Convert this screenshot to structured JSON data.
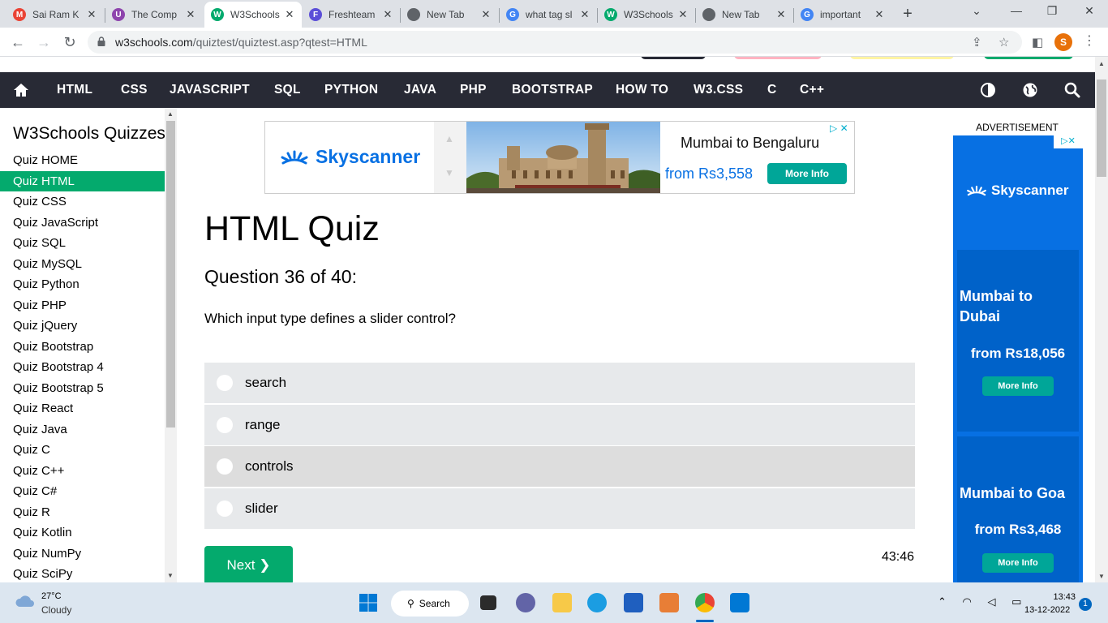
{
  "browser": {
    "tabs": [
      {
        "title": "Sai Ram K",
        "icon": "gmail-icon",
        "color": "#ea4335",
        "glyph": "M"
      },
      {
        "title": "The Comp",
        "icon": "app-icon",
        "color": "#8e44ad",
        "glyph": "U"
      },
      {
        "title": "W3Schools",
        "icon": "w3schools-icon",
        "color": "#04aa6d",
        "glyph": "W"
      },
      {
        "title": "Freshteam",
        "icon": "freshteam-icon",
        "color": "#5b4ed8",
        "glyph": "F"
      },
      {
        "title": "New Tab",
        "icon": "chrome-icon",
        "color": "#5f6368",
        "glyph": ""
      },
      {
        "title": "what tag sl",
        "icon": "google-icon",
        "color": "#4285f4",
        "glyph": "G"
      },
      {
        "title": "W3Schools",
        "icon": "w3schools-icon",
        "color": "#04aa6d",
        "glyph": "W"
      },
      {
        "title": "New Tab",
        "icon": "chrome-icon",
        "color": "#5f6368",
        "glyph": ""
      },
      {
        "title": "important",
        "icon": "google-icon",
        "color": "#4285f4",
        "glyph": "G"
      }
    ],
    "active_tab": 2,
    "url_host": "w3schools.com",
    "url_path": "/quiztest/quiztest.asp?qtest=HTML",
    "profile_initial": "S"
  },
  "topnav": {
    "items": [
      "HTML",
      "CSS",
      "JAVASCRIPT",
      "SQL",
      "PYTHON",
      "JAVA",
      "PHP",
      "BOOTSTRAP",
      "HOW TO",
      "W3.CSS",
      "C",
      "C++"
    ],
    "bg_color": "#282a35"
  },
  "sidebar": {
    "title": "W3Schools Quizzes",
    "items": [
      "Quiz HOME",
      "Quiz HTML",
      "Quiz CSS",
      "Quiz JavaScript",
      "Quiz SQL",
      "Quiz MySQL",
      "Quiz Python",
      "Quiz PHP",
      "Quiz jQuery",
      "Quiz Bootstrap",
      "Quiz Bootstrap 4",
      "Quiz Bootstrap 5",
      "Quiz React",
      "Quiz Java",
      "Quiz C",
      "Quiz C++",
      "Quiz C#",
      "Quiz R",
      "Quiz Kotlin",
      "Quiz NumPy",
      "Quiz SciPy"
    ],
    "active_index": 1,
    "accent_color": "#04aa6d"
  },
  "ad_top": {
    "brand": "Skyscanner",
    "route": "Mumbai to Bengaluru",
    "price": "from Rs3,558",
    "button": "More Info"
  },
  "quiz": {
    "title": "HTML Quiz",
    "question_count": "Question 36 of 40:",
    "question": "Which input type defines a slider control?",
    "answers": [
      "search",
      "range",
      "controls",
      "slider"
    ],
    "hover_index": 2,
    "next_label": "Next ❯",
    "timer": "43:46"
  },
  "ad_right": {
    "label": "ADVERTISEMENT",
    "brand": "Skyscanner",
    "offers": [
      {
        "route": "Mumbai to Dubai",
        "price": "from Rs18,056",
        "button": "More Info"
      },
      {
        "route": "Mumbai to Goa",
        "price": "from Rs3,468",
        "button": "More Info"
      }
    ]
  },
  "taskbar": {
    "temperature": "27°C",
    "weather": "Cloudy",
    "search_label": "Search",
    "time": "13:43",
    "date": "13-12-2022",
    "notifications": "1"
  }
}
